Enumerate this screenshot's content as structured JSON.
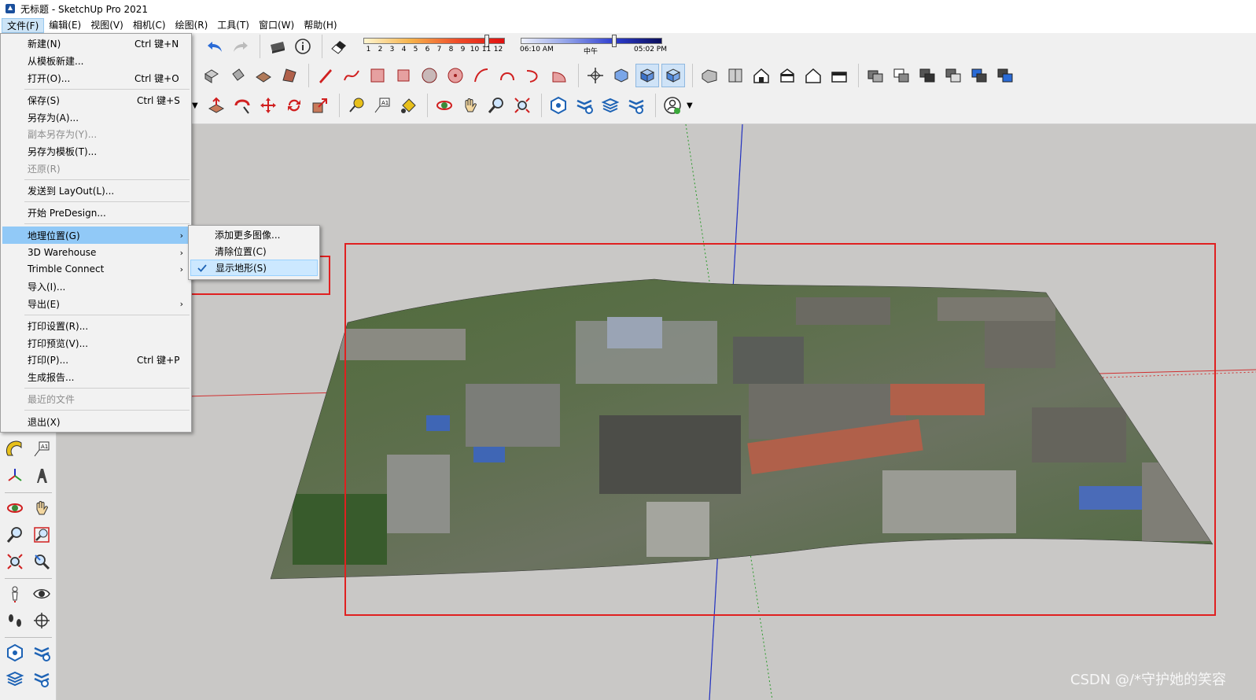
{
  "window": {
    "title": "无标题 - SketchUp Pro 2021"
  },
  "menubar": [
    {
      "label": "文件(F)"
    },
    {
      "label": "编辑(E)"
    },
    {
      "label": "视图(V)"
    },
    {
      "label": "相机(C)"
    },
    {
      "label": "绘图(R)"
    },
    {
      "label": "工具(T)"
    },
    {
      "label": "窗口(W)"
    },
    {
      "label": "帮助(H)"
    }
  ],
  "file_menu": [
    {
      "label": "新建(N)",
      "shortcut": "Ctrl 键+N"
    },
    {
      "label": "从模板新建..."
    },
    {
      "label": "打开(O)...",
      "shortcut": "Ctrl 键+O"
    },
    {
      "label": "保存(S)",
      "shortcut": "Ctrl 键+S"
    },
    {
      "label": "另存为(A)..."
    },
    {
      "label": "副本另存为(Y)..."
    },
    {
      "label": "另存为模板(T)..."
    },
    {
      "label": "还原(R)"
    },
    {
      "label": "发送到 LayOut(L)..."
    },
    {
      "label": "开始 PreDesign..."
    },
    {
      "label": "地理位置(G)"
    },
    {
      "label": "3D Warehouse"
    },
    {
      "label": "Trimble Connect"
    },
    {
      "label": "导入(I)..."
    },
    {
      "label": "导出(E)"
    },
    {
      "label": "打印设置(R)..."
    },
    {
      "label": "打印预览(V)..."
    },
    {
      "label": "打印(P)...",
      "shortcut": "Ctrl 键+P"
    },
    {
      "label": "生成报告..."
    },
    {
      "label": "最近的文件"
    },
    {
      "label": "退出(X)"
    }
  ],
  "geo_submenu": [
    {
      "label": "添加更多图像..."
    },
    {
      "label": "清除位置(C)"
    },
    {
      "label": "显示地形(S)",
      "checked": true
    }
  ],
  "shadow": {
    "months": [
      "1",
      "2",
      "3",
      "4",
      "5",
      "6",
      "7",
      "8",
      "9",
      "10",
      "11",
      "12"
    ],
    "time_start": "06:10 AM",
    "time_mid": "中午",
    "time_end": "05:02 PM"
  },
  "watermark": "CSDN @/*守护她的笑容",
  "colors": {
    "highlight_box": "#e02020",
    "menu_hover": "#91c9f7",
    "axis_red": "#d03030",
    "axis_green": "#2a9a2a",
    "axis_blue": "#2030c0"
  }
}
